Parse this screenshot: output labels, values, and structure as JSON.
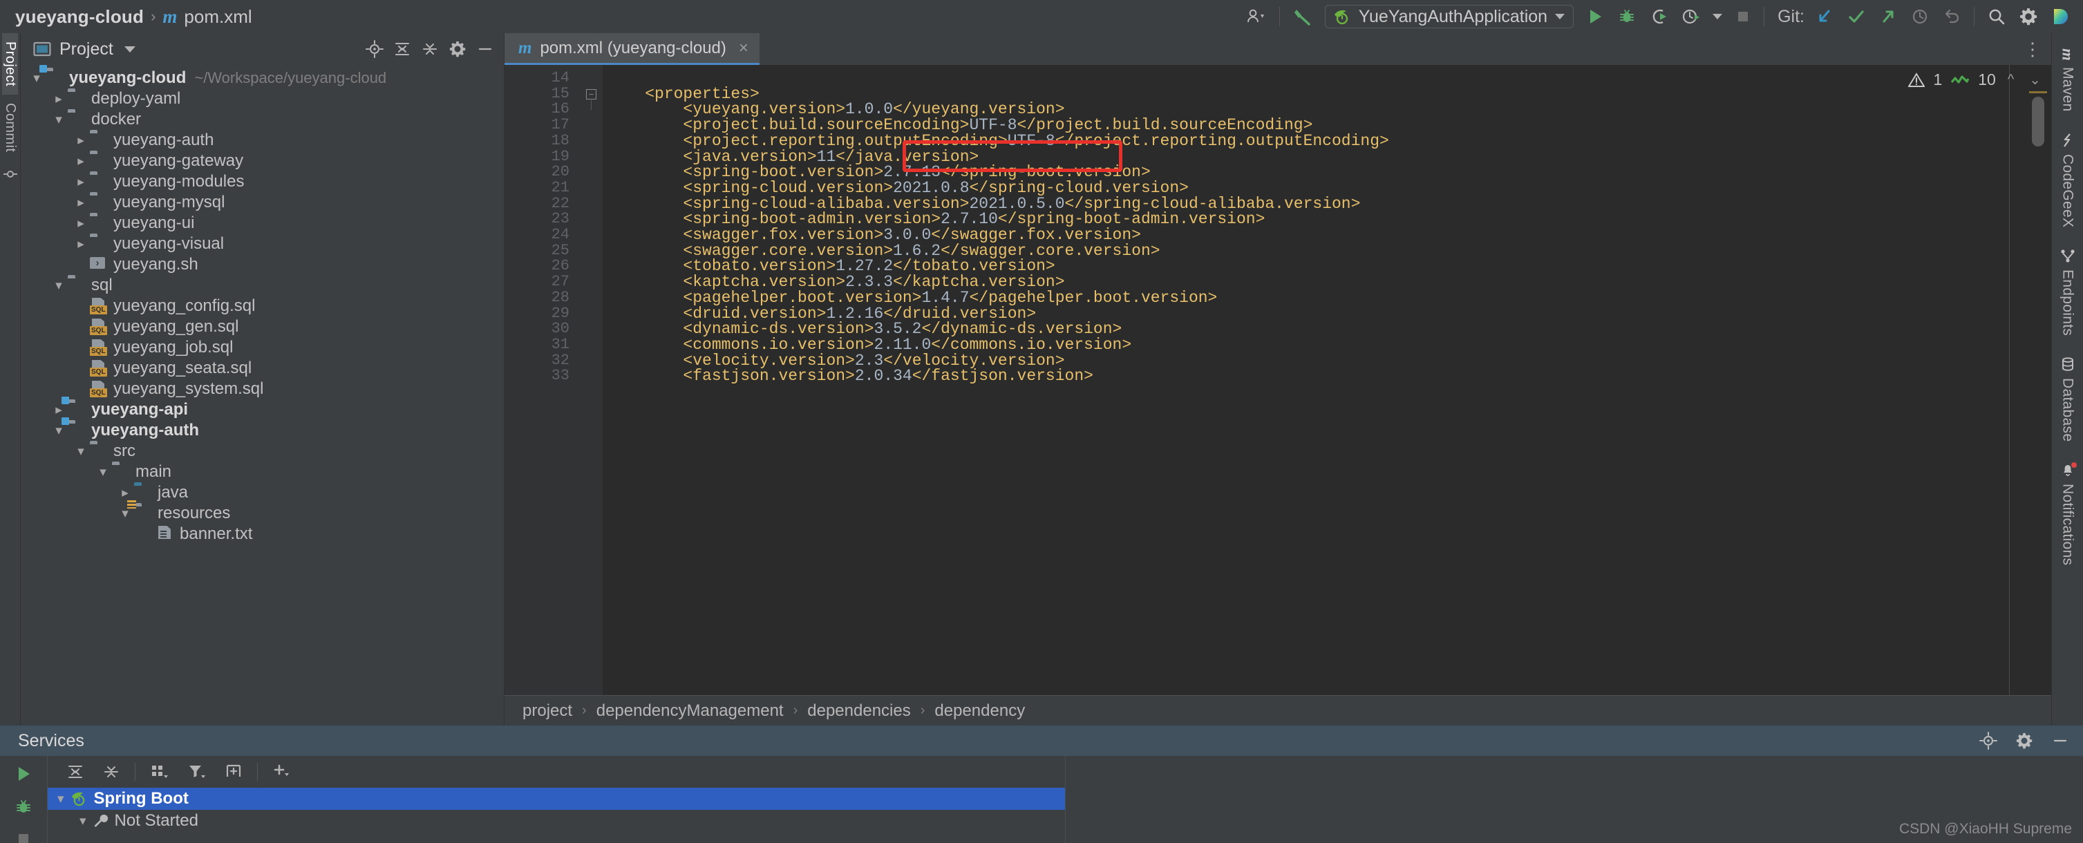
{
  "titlebar": {
    "project_name": "yueyang-cloud",
    "separator": "›",
    "maven_glyph": "m",
    "file_name": "pom.xml",
    "run_config": "YueYangAuthApplication",
    "git_label": "Git:",
    "icons": {
      "user": "user-settings-icon",
      "build": "build-hammer-icon",
      "spring_leaf": "spring-boot-leaf-icon",
      "run": "run-icon",
      "debug": "debug-icon",
      "run_coverage": "run-with-coverage-icon",
      "profiler": "profiler-icon",
      "stop": "stop-icon",
      "git_update": "git-update-project-icon",
      "git_commit": "git-commit-icon",
      "git_push": "git-push-icon",
      "git_history": "git-history-icon",
      "git_rollback": "git-rollback-icon",
      "search": "search-everywhere-icon",
      "settings": "settings-gear-icon",
      "ide_logo": "intellij-logo-icon"
    }
  },
  "left_strip": {
    "tabs": [
      {
        "label": "Project",
        "selected": true,
        "icon": "project-icon"
      },
      {
        "label": "Commit",
        "selected": false,
        "icon": "commit-icon"
      }
    ]
  },
  "right_strip": {
    "tabs": [
      {
        "label": "Maven",
        "icon": "maven-icon"
      },
      {
        "label": "CodeGeeX",
        "icon": "codegeex-icon"
      },
      {
        "label": "Endpoints",
        "icon": "endpoints-icon"
      },
      {
        "label": "Database",
        "icon": "database-icon"
      },
      {
        "label": "Notifications",
        "icon": "notifications-bell-icon",
        "badge": true
      }
    ]
  },
  "project_panel": {
    "title": "Project",
    "tree": [
      {
        "depth": 0,
        "arrow": "down",
        "label": "yueyang-cloud",
        "path": "~/Workspace/yueyang-cloud",
        "icon": "module-folder",
        "bold": true
      },
      {
        "depth": 1,
        "arrow": "right",
        "label": "deploy-yaml",
        "icon": "folder"
      },
      {
        "depth": 1,
        "arrow": "down",
        "label": "docker",
        "icon": "folder"
      },
      {
        "depth": 2,
        "arrow": "right",
        "label": "yueyang-auth",
        "icon": "folder"
      },
      {
        "depth": 2,
        "arrow": "right",
        "label": "yueyang-gateway",
        "icon": "folder"
      },
      {
        "depth": 2,
        "arrow": "right",
        "label": "yueyang-modules",
        "icon": "folder"
      },
      {
        "depth": 2,
        "arrow": "right",
        "label": "yueyang-mysql",
        "icon": "folder"
      },
      {
        "depth": 2,
        "arrow": "right",
        "label": "yueyang-ui",
        "icon": "folder"
      },
      {
        "depth": 2,
        "arrow": "right",
        "label": "yueyang-visual",
        "icon": "folder"
      },
      {
        "depth": 2,
        "arrow": "none",
        "label": "yueyang.sh",
        "icon": "shell-file"
      },
      {
        "depth": 1,
        "arrow": "down",
        "label": "sql",
        "icon": "folder"
      },
      {
        "depth": 2,
        "arrow": "none",
        "label": "yueyang_config.sql",
        "icon": "sql-file"
      },
      {
        "depth": 2,
        "arrow": "none",
        "label": "yueyang_gen.sql",
        "icon": "sql-file"
      },
      {
        "depth": 2,
        "arrow": "none",
        "label": "yueyang_job.sql",
        "icon": "sql-file"
      },
      {
        "depth": 2,
        "arrow": "none",
        "label": "yueyang_seata.sql",
        "icon": "sql-file"
      },
      {
        "depth": 2,
        "arrow": "none",
        "label": "yueyang_system.sql",
        "icon": "sql-file"
      },
      {
        "depth": 1,
        "arrow": "right",
        "label": "yueyang-api",
        "icon": "module-folder",
        "bold": true
      },
      {
        "depth": 1,
        "arrow": "down",
        "label": "yueyang-auth",
        "icon": "module-folder",
        "bold": true
      },
      {
        "depth": 2,
        "arrow": "down",
        "label": "src",
        "icon": "folder"
      },
      {
        "depth": 3,
        "arrow": "down",
        "label": "main",
        "icon": "folder"
      },
      {
        "depth": 4,
        "arrow": "right",
        "label": "java",
        "icon": "source-folder"
      },
      {
        "depth": 4,
        "arrow": "down",
        "label": "resources",
        "icon": "resource-folder"
      },
      {
        "depth": 5,
        "arrow": "none",
        "label": "banner.txt",
        "icon": "text-file"
      }
    ]
  },
  "editor": {
    "tab": {
      "maven_glyph": "m",
      "label": "pom.xml (yueyang-cloud)",
      "close": "×"
    },
    "inspection": {
      "warning_count": "1",
      "ok_count": "10"
    },
    "first_line_number": 14,
    "lines": [
      {
        "n": 14,
        "segments": []
      },
      {
        "n": 15,
        "segments": [
          {
            "t": "tag",
            "s": "    <properties>"
          }
        ]
      },
      {
        "n": 16,
        "segments": [
          {
            "t": "tag",
            "s": "        <yueyang.version>"
          },
          {
            "t": "val",
            "s": "1.0.0"
          },
          {
            "t": "tag",
            "s": "</yueyang.version>"
          }
        ]
      },
      {
        "n": 17,
        "segments": [
          {
            "t": "tag",
            "s": "        <project.build.sourceEncoding>"
          },
          {
            "t": "val",
            "s": "UTF-8"
          },
          {
            "t": "tag",
            "s": "</project.build.sourceEncoding>"
          }
        ]
      },
      {
        "n": 18,
        "segments": [
          {
            "t": "tag",
            "s": "        <project.reporting.outputEncoding>"
          },
          {
            "t": "val",
            "s": "UTF-8"
          },
          {
            "t": "tag",
            "s": "</project.reporting.outputEncoding>"
          }
        ]
      },
      {
        "n": 19,
        "segments": [
          {
            "t": "tag",
            "s": "        <java.version>"
          },
          {
            "t": "val",
            "s": "11"
          },
          {
            "t": "tag",
            "s": "</java.version>"
          }
        ]
      },
      {
        "n": 20,
        "segments": [
          {
            "t": "tag",
            "s": "        <spring-boot.version>"
          },
          {
            "t": "val",
            "s": "2.7.13"
          },
          {
            "t": "tag",
            "s": "</spring-boot.version>"
          }
        ]
      },
      {
        "n": 21,
        "segments": [
          {
            "t": "tag",
            "s": "        <spring-cloud.version>"
          },
          {
            "t": "val",
            "s": "2021.0.8"
          },
          {
            "t": "tag",
            "s": "</spring-cloud.version>"
          }
        ]
      },
      {
        "n": 22,
        "segments": [
          {
            "t": "tag",
            "s": "        <spring-cloud-alibaba.version>"
          },
          {
            "t": "val",
            "s": "2021.0.5.0"
          },
          {
            "t": "tag",
            "s": "</spring-cloud-alibaba.version>"
          }
        ]
      },
      {
        "n": 23,
        "segments": [
          {
            "t": "tag",
            "s": "        <spring-boot-admin.version>"
          },
          {
            "t": "val",
            "s": "2.7.10"
          },
          {
            "t": "tag",
            "s": "</spring-boot-admin.version>"
          }
        ]
      },
      {
        "n": 24,
        "segments": [
          {
            "t": "tag",
            "s": "        <swagger.fox.version>"
          },
          {
            "t": "val",
            "s": "3.0.0"
          },
          {
            "t": "tag",
            "s": "</swagger.fox.version>"
          }
        ]
      },
      {
        "n": 25,
        "segments": [
          {
            "t": "tag",
            "s": "        <swagger.core.version>"
          },
          {
            "t": "val",
            "s": "1.6.2"
          },
          {
            "t": "tag",
            "s": "</swagger.core.version>"
          }
        ]
      },
      {
        "n": 26,
        "segments": [
          {
            "t": "tag",
            "s": "        <tobato.version>"
          },
          {
            "t": "val",
            "s": "1.27.2"
          },
          {
            "t": "tag",
            "s": "</tobato.version>"
          }
        ]
      },
      {
        "n": 27,
        "segments": [
          {
            "t": "tag",
            "s": "        <kaptcha.version>"
          },
          {
            "t": "val",
            "s": "2.3.3"
          },
          {
            "t": "tag",
            "s": "</kaptcha.version>"
          }
        ]
      },
      {
        "n": 28,
        "segments": [
          {
            "t": "tag",
            "s": "        <pagehelper.boot.version>"
          },
          {
            "t": "val",
            "s": "1.4.7"
          },
          {
            "t": "tag",
            "s": "</pagehelper.boot.version>"
          }
        ]
      },
      {
        "n": 29,
        "segments": [
          {
            "t": "tag",
            "s": "        <druid.version>"
          },
          {
            "t": "val",
            "s": "1.2.16"
          },
          {
            "t": "tag",
            "s": "</druid.version>"
          }
        ]
      },
      {
        "n": 30,
        "segments": [
          {
            "t": "tag",
            "s": "        <dynamic-ds.version>"
          },
          {
            "t": "val",
            "s": "3.5.2"
          },
          {
            "t": "tag",
            "s": "</dynamic-ds.version>"
          }
        ]
      },
      {
        "n": 31,
        "segments": [
          {
            "t": "tag",
            "s": "        <commons.io.version>"
          },
          {
            "t": "val",
            "s": "2.11.0"
          },
          {
            "t": "tag",
            "s": "</commons.io.version>"
          }
        ]
      },
      {
        "n": 32,
        "segments": [
          {
            "t": "tag",
            "s": "        <velocity.version>"
          },
          {
            "t": "val",
            "s": "2.3"
          },
          {
            "t": "tag",
            "s": "</velocity.version>"
          }
        ]
      },
      {
        "n": 33,
        "segments": [
          {
            "t": "tag",
            "s": "        <fastjson.version>"
          },
          {
            "t": "val",
            "s": "2.0.34"
          },
          {
            "t": "tag",
            "s": "</fastjson.version>"
          }
        ]
      }
    ],
    "annotation": {
      "type": "red-rectangle",
      "target_line": 19,
      "color": "#e8312a"
    },
    "breadcrumb": [
      "project",
      "dependencyManagement",
      "dependencies",
      "dependency"
    ]
  },
  "services": {
    "title": "Services",
    "toolbar_icons": [
      "expand-all-icon",
      "collapse-all-icon",
      "group-by-icon",
      "filter-icon",
      "add-frame-icon",
      "add-service-icon"
    ],
    "gutter_icons": [
      "run-icon",
      "debug-icon",
      "stop-icon"
    ],
    "tree": [
      {
        "depth": 0,
        "arrow": "down",
        "label": "Spring Boot",
        "icon": "spring-boot-icon",
        "selected": true
      },
      {
        "depth": 1,
        "arrow": "down",
        "label": "Not Started",
        "icon": "wrench-icon",
        "selected": false
      }
    ]
  },
  "watermark": "CSDN @XiaoHH Supreme",
  "colors": {
    "accent_blue": "#4a9fd4",
    "selection_blue": "#2f5fc0",
    "services_header": "#41515e",
    "annotation_red": "#e8312a",
    "xml_tag": "#e8bf6a",
    "xml_value": "#a9b7c6",
    "editor_bg": "#2b2b2b",
    "panel_bg": "#3c3f41",
    "green": "#59a869"
  }
}
